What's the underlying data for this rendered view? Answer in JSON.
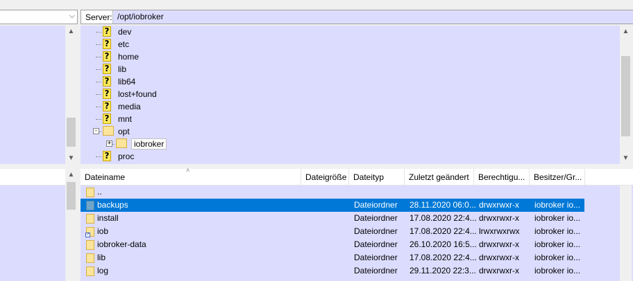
{
  "server": {
    "label": "Server:",
    "path": "/opt/iobroker"
  },
  "tree": [
    {
      "label": "dev",
      "icon": "question-icon",
      "level": 1
    },
    {
      "label": "etc",
      "icon": "question-icon",
      "level": 1
    },
    {
      "label": "home",
      "icon": "question-icon",
      "level": 1
    },
    {
      "label": "lib",
      "icon": "question-icon",
      "level": 1
    },
    {
      "label": "lib64",
      "icon": "question-icon",
      "level": 1
    },
    {
      "label": "lost+found",
      "icon": "question-icon",
      "level": 1
    },
    {
      "label": "media",
      "icon": "question-icon",
      "level": 1
    },
    {
      "label": "mnt",
      "icon": "question-icon",
      "level": 1
    },
    {
      "label": "opt",
      "icon": "folder-icon",
      "level": 1,
      "expander": "minus"
    },
    {
      "label": "iobroker",
      "icon": "folder-icon",
      "level": 2,
      "expander": "plus",
      "selected": true
    },
    {
      "label": "proc",
      "icon": "question-icon",
      "level": 1
    }
  ],
  "list": {
    "columns": [
      "Dateiname",
      "Dateigröße",
      "Dateityp",
      "Zuletzt geändert",
      "Berechtigu...",
      "Besitzer/Gr..."
    ],
    "rows": [
      {
        "name": "..",
        "size": "",
        "type": "",
        "modified": "",
        "perms": "",
        "owner": "",
        "icon": "folder-icon"
      },
      {
        "name": "backups",
        "size": "",
        "type": "Dateiordner",
        "modified": "28.11.2020 06:0...",
        "perms": "drwxrwxr-x",
        "owner": "iobroker io...",
        "icon": "folder-icon",
        "selected": true
      },
      {
        "name": "install",
        "size": "",
        "type": "Dateiordner",
        "modified": "17.08.2020 22:4...",
        "perms": "drwxrwxr-x",
        "owner": "iobroker io...",
        "icon": "folder-icon"
      },
      {
        "name": "iob",
        "size": "",
        "type": "Dateiordner",
        "modified": "17.08.2020 22:4...",
        "perms": "lrwxrwxrwx",
        "owner": "iobroker io...",
        "icon": "folder-link-icon"
      },
      {
        "name": "iobroker-data",
        "size": "",
        "type": "Dateiordner",
        "modified": "26.10.2020 16:5...",
        "perms": "drwxrwxr-x",
        "owner": "iobroker io...",
        "icon": "folder-icon"
      },
      {
        "name": "lib",
        "size": "",
        "type": "Dateiordner",
        "modified": "17.08.2020 22:4...",
        "perms": "drwxrwxr-x",
        "owner": "iobroker io...",
        "icon": "folder-icon"
      },
      {
        "name": "log",
        "size": "",
        "type": "Dateiordner",
        "modified": "29.11.2020 22:3...",
        "perms": "drwxrwxr-x",
        "owner": "iobroker io...",
        "icon": "folder-icon"
      }
    ]
  }
}
